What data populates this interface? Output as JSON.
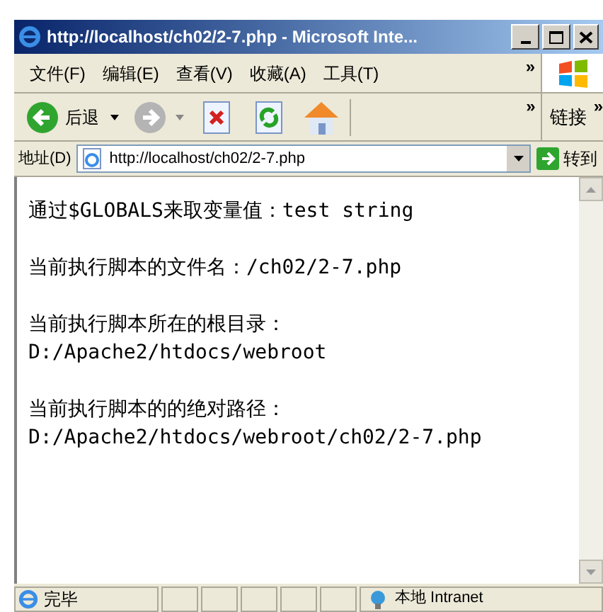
{
  "window": {
    "title": "http://localhost/ch02/2-7.php - Microsoft Inte..."
  },
  "menu": [
    {
      "label": "文件(F)"
    },
    {
      "label": "编辑(E)"
    },
    {
      "label": "查看(V)"
    },
    {
      "label": "收藏(A)"
    },
    {
      "label": "工具(T)"
    }
  ],
  "menu_more": "»",
  "toolbar": {
    "back_label": "后退",
    "more": "»",
    "links_label": "链接",
    "links_more": "»"
  },
  "address": {
    "label": "地址(D)",
    "value": "http://localhost/ch02/2-7.php",
    "go_label": "转到"
  },
  "content": [
    {
      "lines": [
        "通过$GLOBALS来取变量值：test string"
      ]
    },
    {
      "lines": [
        "当前执行脚本的文件名：/ch02/2-7.php"
      ]
    },
    {
      "lines": [
        "当前执行脚本所在的根目录：",
        "D:/Apache2/htdocs/webroot"
      ]
    },
    {
      "lines": [
        "当前执行脚本的的绝对路径：",
        "D:/Apache2/htdocs/webroot/ch02/2-7.php"
      ]
    }
  ],
  "status_bar": {
    "text": "完毕",
    "zone": "本地 Intranet"
  }
}
